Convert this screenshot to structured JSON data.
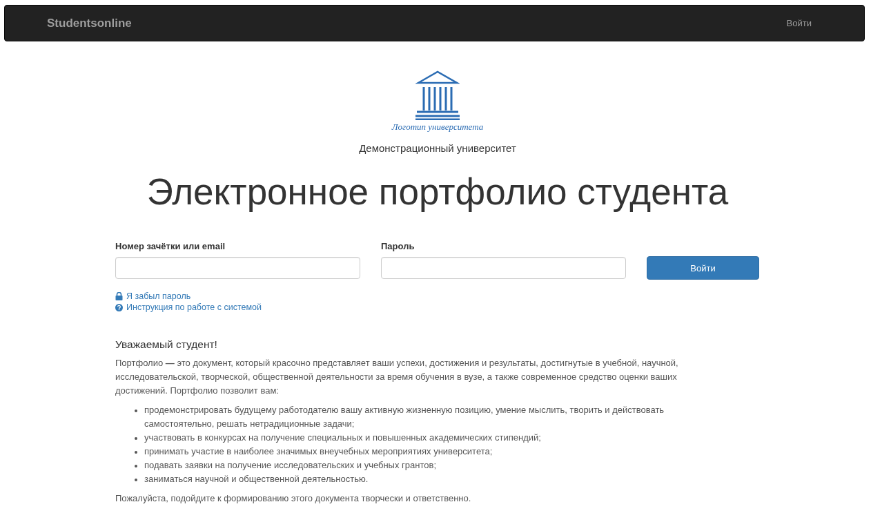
{
  "navbar": {
    "brand": "Studentsonline",
    "login_link": "Войти"
  },
  "logo": {
    "caption": "Логотип университета"
  },
  "university": "Демонстрационный университет",
  "title": "Электронное портфолио студента",
  "form": {
    "fields": [
      {
        "label": "Номер зачётки или email"
      },
      {
        "label": "Пароль"
      }
    ],
    "submit": "Войти",
    "links": [
      {
        "text": "Я забыл пароль",
        "kind": "lock"
      },
      {
        "text": "Инструкция по работе с системой",
        "kind": "help"
      }
    ]
  },
  "intro": {
    "heading": "Уважаемый студент!",
    "paragraph": "Портфолио **—** это документ, который красочно представляет ваши успехи, достижения и результаты, достигнутые в учебной, научной, исследовательской, творческой, общественной деятельности за время обучения в вузе, а также современное средство оценки ваших достижений. Портфолио позволит вам:",
    "bullets": [
      "продемонстрировать будущему работодателю вашу активную жизненную позицию, умение мыслить, творить и действовать самостоятельно, решать нетрадиционные задачи;",
      "участвовать в конкурсах на получение специальных и повышенных академических стипендий;",
      "принимать участие в наиболее значимых внеучебных мероприятиях университета;",
      "подавать заявки на получение исследовательских и учебных грантов;",
      "заниматься научной и общественной деятельностью."
    ],
    "closing": "Пожалуйста, подойдите к формированию этого документа творчески и ответственно."
  }
}
